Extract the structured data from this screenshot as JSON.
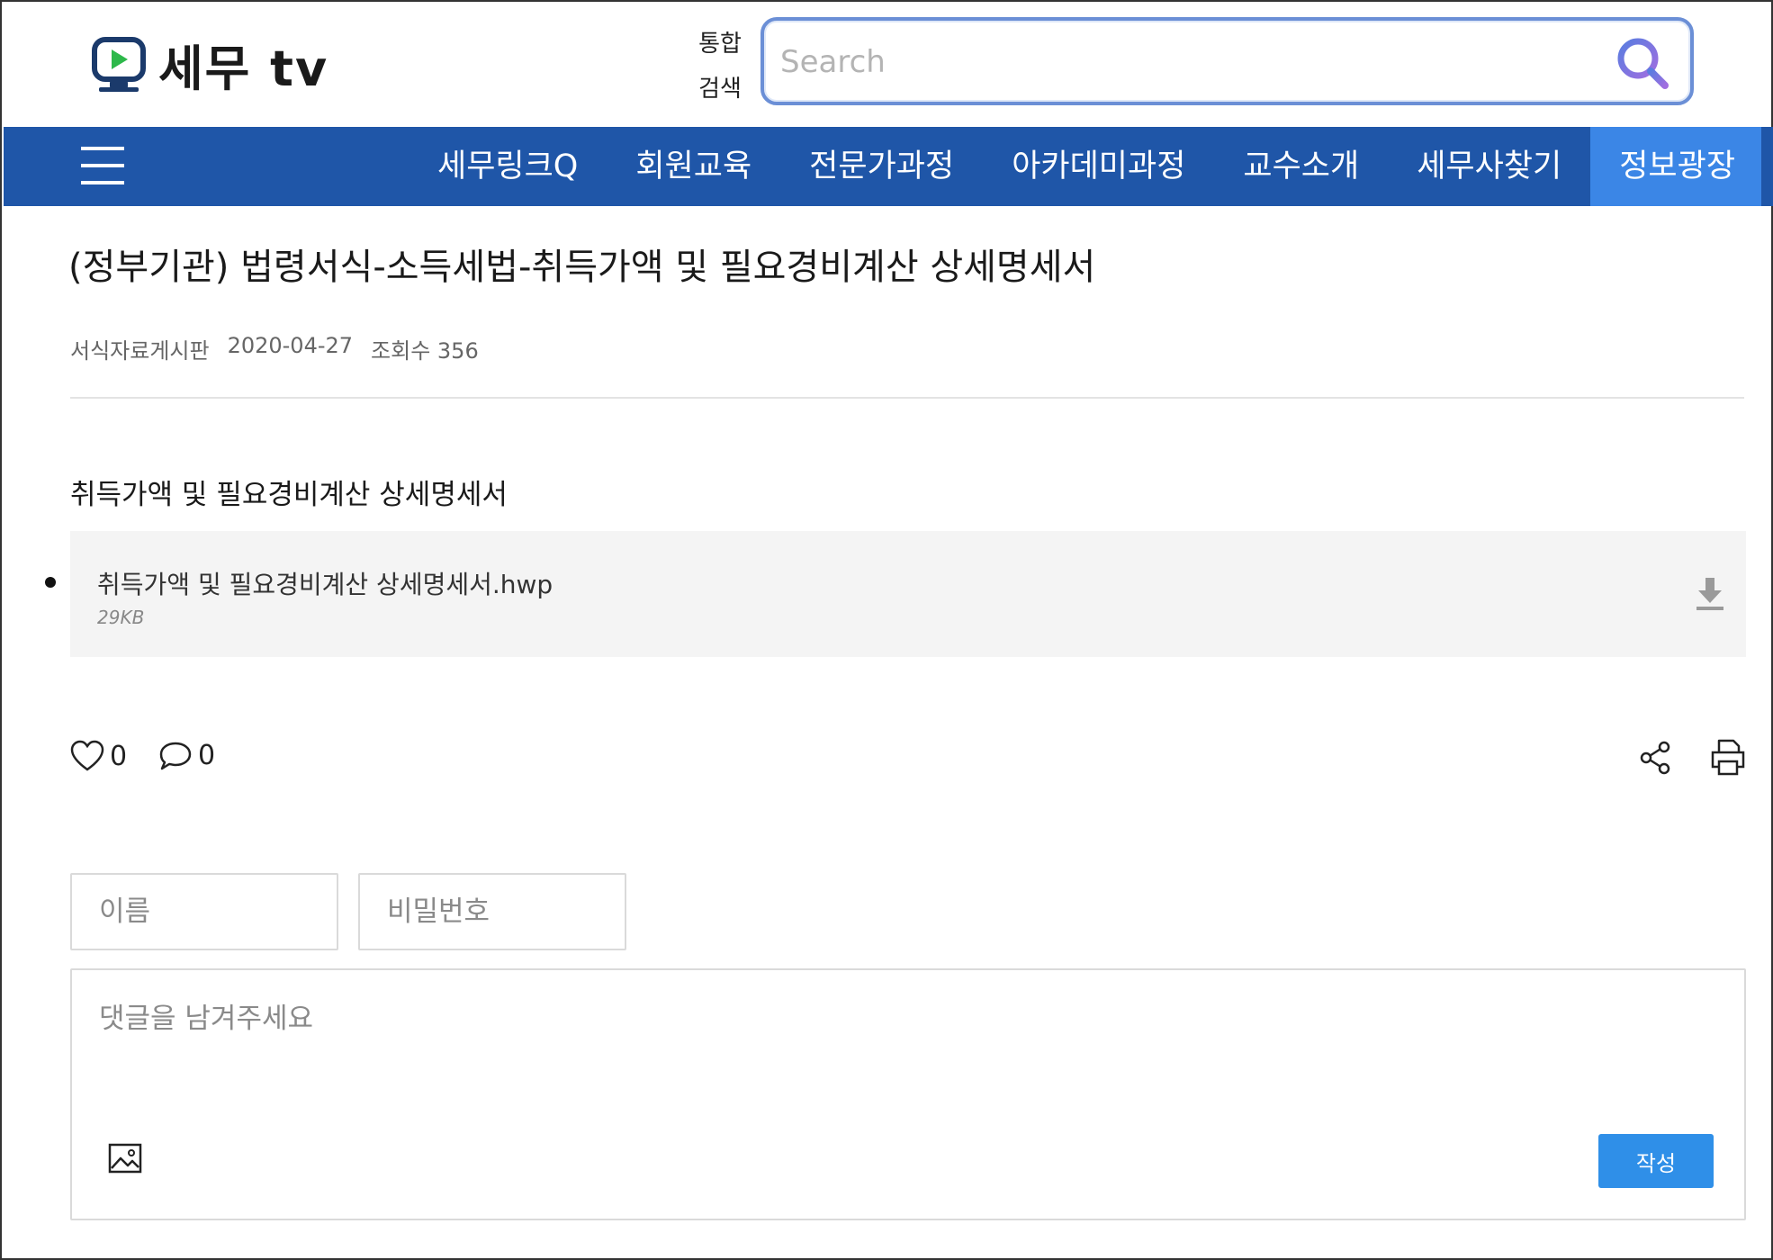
{
  "header": {
    "logo_text": "세무 tv",
    "search_label_line1": "통합",
    "search_label_line2": "검색",
    "search_placeholder": "Search"
  },
  "nav": {
    "items": [
      {
        "label": "세무링크Q"
      },
      {
        "label": "회원교육"
      },
      {
        "label": "전문가과정"
      },
      {
        "label": "아카데미과정"
      },
      {
        "label": "교수소개"
      },
      {
        "label": "세무사찾기"
      },
      {
        "label": "정보광장",
        "active": true
      }
    ]
  },
  "post": {
    "title": "(정부기관)  법령서식-소득세법-취득가액 및 필요경비계산 상세명세서",
    "board": "서식자료게시판",
    "date": "2020-04-27",
    "views": "조회수 356",
    "body": "취득가액 및 필요경비계산 상세명세서",
    "attachment": {
      "name": "취득가액 및 필요경비계산 상세명세서.hwp",
      "size": "29KB"
    }
  },
  "reactions": {
    "likes": "0",
    "comments": "0"
  },
  "comment_form": {
    "name_placeholder": "이름",
    "password_placeholder": "비밀번호",
    "comment_placeholder": "댓글을 남겨주세요",
    "submit_label": "작성"
  },
  "colors": {
    "nav_bg": "#1f56a8",
    "nav_active": "#3b86e6",
    "search_border": "#6b8fd6",
    "submit_bg": "#2f8fe8"
  }
}
